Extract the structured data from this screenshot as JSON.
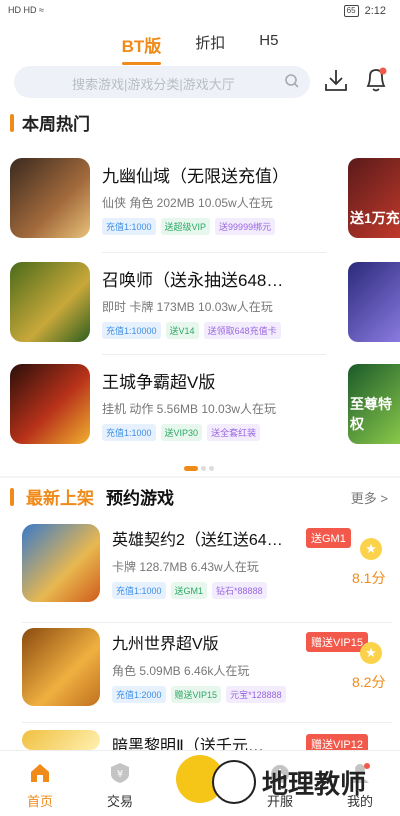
{
  "status": {
    "left": "HD HD ≈",
    "battery": "65",
    "time": "2:12"
  },
  "tabs": [
    "BT版",
    "折扣",
    "H5"
  ],
  "search": {
    "placeholder": "搜索游戏|游戏分类|游戏大厅"
  },
  "hot": {
    "title": "本周热门",
    "games": [
      {
        "name": "九幽仙域（无限送充值）",
        "meta": "仙侠 角色   202MB   10.05w人在玩",
        "tags": [
          "充值1:1000",
          "送超级VIP",
          "送99999绑元"
        ],
        "peek": "送1万充"
      },
      {
        "name": "召唤师（送永抽送648…",
        "meta": "即时 卡牌   173MB   10.03w人在玩",
        "tags": [
          "充值1:10000",
          "送V14",
          "送领取648充值卡"
        ],
        "peek": ""
      },
      {
        "name": "王城争霸超V版",
        "meta": "挂机 动作   5.56MB   10.03w人在玩",
        "tags": [
          "充值1:1000",
          "送VIP30",
          "送全套红装"
        ],
        "peek": "至尊特权"
      }
    ]
  },
  "latest": {
    "tabs": [
      "最新上架",
      "预约游戏"
    ],
    "more": "更多 >",
    "games": [
      {
        "name": "英雄契约2（送红送64…",
        "badge": "送GM1",
        "meta": "卡牌   128.7MB   6.43w人在玩",
        "tags": [
          "充值1:1000",
          "送GM1",
          "钻石*88888"
        ],
        "score": "8.1分"
      },
      {
        "name": "九州世界超V版",
        "badge": "赠送VIP15",
        "meta": "角色   5.09MB   6.46k人在玩",
        "tags": [
          "充值1:2000",
          "赠送VIP15",
          "元宝*128888"
        ],
        "score": "8.2分"
      },
      {
        "name": "暗黑黎明Ⅱ（送千元…",
        "badge": "赠送VIP12",
        "meta": "",
        "tags": [],
        "score": ""
      }
    ]
  },
  "nav": [
    "首页",
    "交易",
    "",
    "开服",
    "我的"
  ],
  "watermark": "地理教师",
  "colors": {
    "accent": "#f08a18",
    "badge": "#f2594b",
    "star": "#fbd24a"
  }
}
